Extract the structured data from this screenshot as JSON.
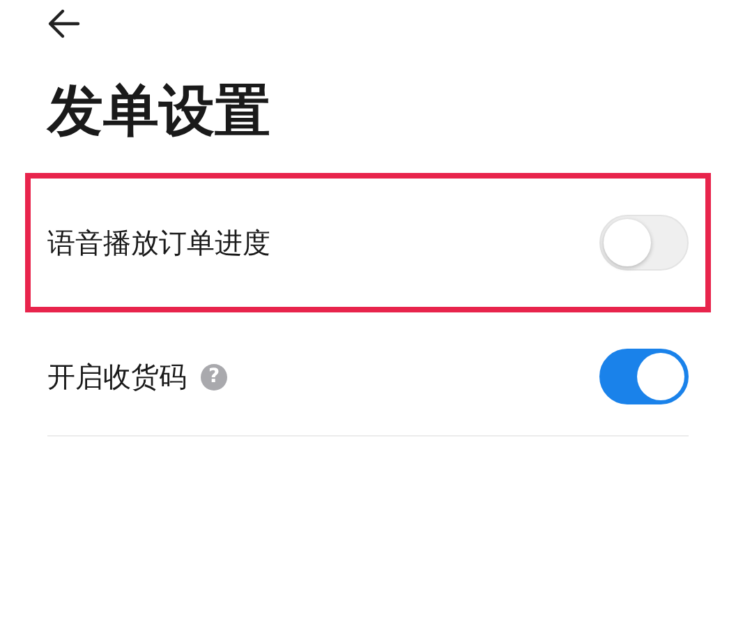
{
  "title": "发单设置",
  "settings": [
    {
      "label": "语音播放订单进度",
      "on": false,
      "highlighted": true
    },
    {
      "label": "开启收货码",
      "help": "?",
      "on": true,
      "highlighted": false
    }
  ]
}
